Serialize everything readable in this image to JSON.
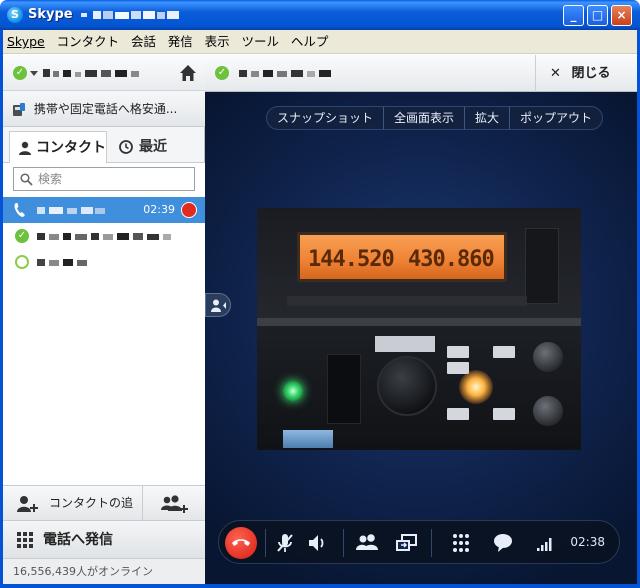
{
  "window": {
    "app_name": "Skype",
    "minimize": "_",
    "maximize": "□",
    "close": "×"
  },
  "menu": [
    "Skype",
    "コンタクト",
    "会話",
    "発信",
    "表示",
    "ツール",
    "ヘルプ"
  ],
  "left": {
    "call_phones": "携帯や固定電話へ格安通...",
    "tabs": {
      "contacts": "コンタクト",
      "recent": "最近"
    },
    "search_placeholder": "検索",
    "active_call_time": "02:39",
    "add_contact": "コンタクトの追加",
    "dial": "電話へ発信",
    "online_count": "16,556,439人がオンライン"
  },
  "call": {
    "close_label": "閉じる",
    "toolbar": [
      "スナップショット",
      "全画面表示",
      "拡大",
      "ポップアウト"
    ],
    "duration": "02:38",
    "lcd_left": "144.520",
    "lcd_right": "430.860"
  },
  "colors": {
    "status_online": "#6cc13d",
    "selection": "#3f8fdc",
    "hangup_red": "#e22a1f",
    "video_bg": "#10244e"
  }
}
